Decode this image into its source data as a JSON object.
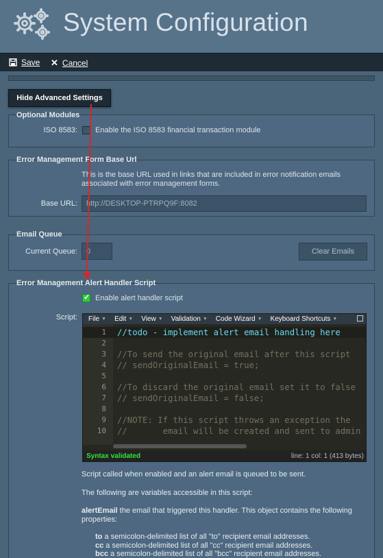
{
  "header": {
    "title": "System Configuration",
    "icon": "gears-icon"
  },
  "toolbar": {
    "save_label": "Save",
    "cancel_label": "Cancel"
  },
  "advanced_button": "Hide Advanced Settings",
  "optional_modules": {
    "legend": "Optional Modules",
    "iso_label": "ISO 8583:",
    "iso_desc": "Enable the ISO 8583 financial transaction module",
    "iso_checked": false
  },
  "error_form": {
    "legend": "Error Management Form Base Url",
    "desc_line1": "This is the base URL used in links that are included in error notification emails",
    "desc_line2": "associated with error management forms.",
    "base_url_label": "Base URL:",
    "base_url_value": "http://DESKTOP-PTRPQ9F:8082"
  },
  "email_queue": {
    "legend": "Email Queue",
    "current_queue_label": "Current Queue:",
    "current_queue_value": "0",
    "clear_button": "Clear Emails"
  },
  "alert_handler": {
    "legend": "Error Management Alert Handler Script",
    "enable_label": "Enable alert handler script",
    "enable_checked": true,
    "script_label": "Script:",
    "menus": [
      "File",
      "Edit",
      "View",
      "Validation",
      "Code Wizard",
      "Keyboard Shortcuts"
    ],
    "lines": [
      {
        "n": "1",
        "text": "//todo - implement alert email handling here"
      },
      {
        "n": "2",
        "text": ""
      },
      {
        "n": "3",
        "text": "//To send the original email after this script"
      },
      {
        "n": "4",
        "text": "// sendOriginalEmail = true;"
      },
      {
        "n": "5",
        "text": ""
      },
      {
        "n": "6",
        "text": "//To discard the original email set it to false"
      },
      {
        "n": "7",
        "text": "// sendOriginalEmail = false;"
      },
      {
        "n": "8",
        "text": ""
      },
      {
        "n": "9",
        "text": "//NOTE: If this script throws an exception the"
      },
      {
        "n": "10",
        "text": "//       email will be created and sent to admin"
      }
    ],
    "status_valid": "Syntax validated",
    "status_pos": "line: 1  col: 1  (413 bytes)",
    "help_1": "Script called when enabled and an alert email is queued to be sent.",
    "help_2": "The following are variables accessible in this script:",
    "help_3_bold": "alertEmail",
    "help_3_rest": " the email that triggered this handler. This object contains the following",
    "help_3_line2": "properties:",
    "props": [
      {
        "name": "to",
        "desc": " a semicolon-delimited list of all \"to\" recipient email addresses."
      },
      {
        "name": "cc",
        "desc": " a semicolon-delimited list of all \"cc\" recipient email addresses."
      },
      {
        "name": "bcc",
        "desc": " a semicolon-delimited list of all \"bcc\" recipient email addresses."
      }
    ]
  },
  "colors": {
    "accent_red": "#d9252a",
    "check_green": "#2ecc40",
    "code_blue": "#66d9ef"
  }
}
